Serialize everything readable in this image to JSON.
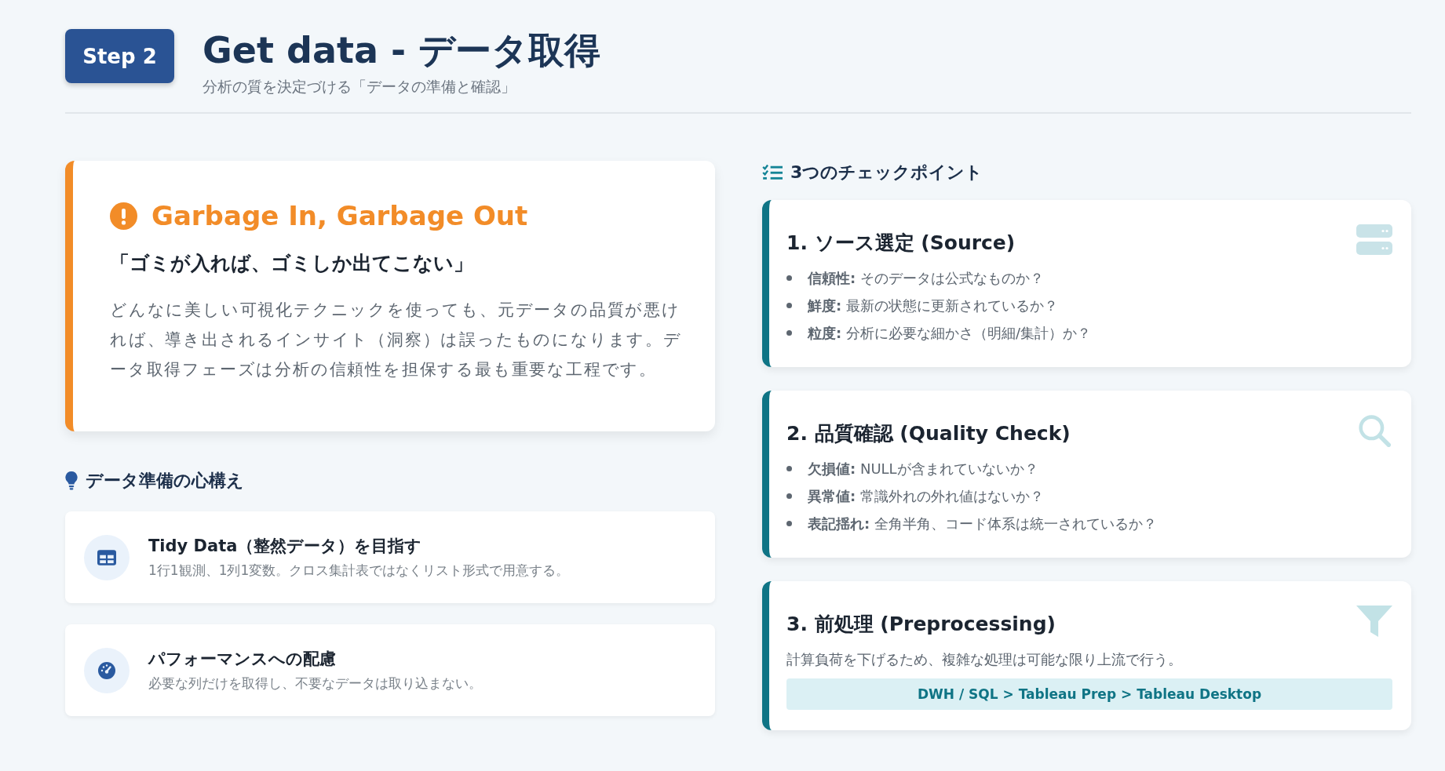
{
  "header": {
    "step": "Step 2",
    "title": "Get data - データ取得",
    "subtitle": "分析の質を決定づける「データの準備と確認」"
  },
  "alert": {
    "title": "Garbage In, Garbage Out",
    "quote": "「ゴミが入れば、ゴミしか出てこない」",
    "body": "どんなに美しい可視化テクニックを使っても、元データの品質が悪ければ、導き出されるインサイト（洞察）は誤ったものになります。データ取得フェーズは分析の信頼性を担保する最も重要な工程です。"
  },
  "mindset": {
    "heading": "データ準備の心構え",
    "items": [
      {
        "kind": "table",
        "title": "Tidy Data（整然データ）を目指す",
        "text": "1行1観測、1列1変数。クロス集計表ではなくリスト形式で用意する。"
      },
      {
        "kind": "gauge",
        "title": "パフォーマンスへの配慮",
        "text": "必要な列だけを取得し、不要なデータは取り込まない。"
      }
    ]
  },
  "checkpoints": {
    "heading": "3つのチェックポイント",
    "items": [
      {
        "kind": "server",
        "title": "1. ソース選定 (Source)",
        "bullets": [
          "**信頼性:** そのデータは公式なものか？",
          "**鮮度:** 最新の状態に更新されているか？",
          "**粒度:** 分析に必要な細かさ（明細/集計）か？"
        ]
      },
      {
        "kind": "search",
        "title": "2. 品質確認 (Quality Check)",
        "bullets": [
          "**欠損値:** NULLが含まれていないか？",
          "**異常値:** 常識外れの外れ値はないか？",
          "**表記揺れ:** 全角半角、コード体系は統一されているか？"
        ]
      },
      {
        "kind": "filter",
        "title": "3. 前処理 (Preprocessing)",
        "text": "計算負荷を下げるため、複雑な処理は可能な限り上流で行う。",
        "flow": "DWH / SQL > Tableau Prep > Tableau Desktop"
      }
    ]
  }
}
